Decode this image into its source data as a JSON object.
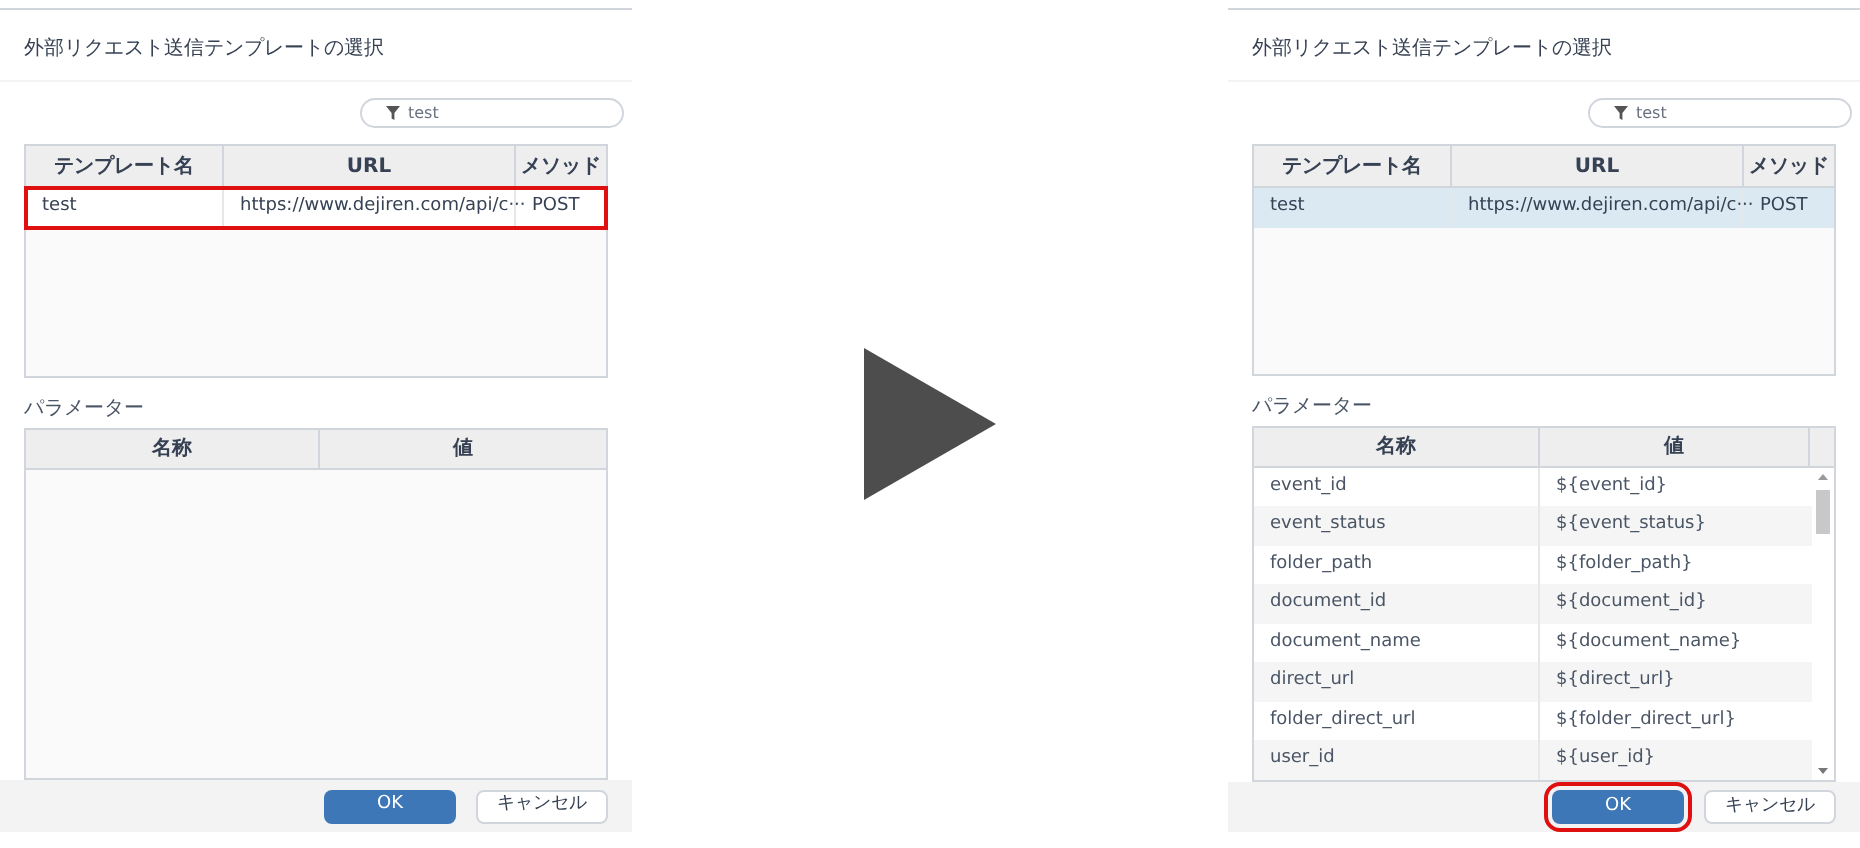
{
  "dialogs": [
    {
      "title": "外部リクエスト送信テンプレートの選択",
      "filter": {
        "value": "test"
      },
      "templates": {
        "columns": [
          "テンプレート名",
          "URL",
          "メソッド"
        ],
        "rows": [
          {
            "name": "test",
            "url": "https://www.dejiren.com/api/c···",
            "method": "POST",
            "selected": false,
            "highlighted": true
          }
        ]
      },
      "params": {
        "label": "パラメーター",
        "columns": [
          "名称",
          "値"
        ],
        "scrollable": false
      },
      "buttons": [
        {
          "label": "OK",
          "kind": "primary",
          "highlighted": false
        },
        {
          "label": "キャンセル",
          "kind": "secondary",
          "highlighted": false
        }
      ]
    },
    {
      "title": "外部リクエスト送信テンプレートの選択",
      "filter": {
        "value": "test"
      },
      "templates": {
        "columns": [
          "テンプレート名",
          "URL",
          "メソッド"
        ],
        "rows": [
          {
            "name": "test",
            "url": "https://www.dejiren.com/api/c···",
            "method": "POST",
            "selected": true,
            "highlighted": false
          }
        ]
      },
      "params": {
        "label": "パラメーター",
        "columns": [
          "名称",
          "値"
        ],
        "scrollable": true,
        "rows": [
          {
            "name": "event_id",
            "value": "${event_id}"
          },
          {
            "name": "event_status",
            "value": "${event_status}"
          },
          {
            "name": "folder_path",
            "value": "${folder_path}"
          },
          {
            "name": "document_id",
            "value": "${document_id}"
          },
          {
            "name": "document_name",
            "value": "${document_name}"
          },
          {
            "name": "direct_url",
            "value": "${direct_url}"
          },
          {
            "name": "folder_direct_url",
            "value": "${folder_direct_url}"
          },
          {
            "name": "user_id",
            "value": "${user_id}"
          }
        ]
      },
      "buttons": [
        {
          "label": "OK",
          "kind": "primary",
          "highlighted": true
        },
        {
          "label": "キャンセル",
          "kind": "secondary",
          "highlighted": false
        }
      ]
    }
  ]
}
